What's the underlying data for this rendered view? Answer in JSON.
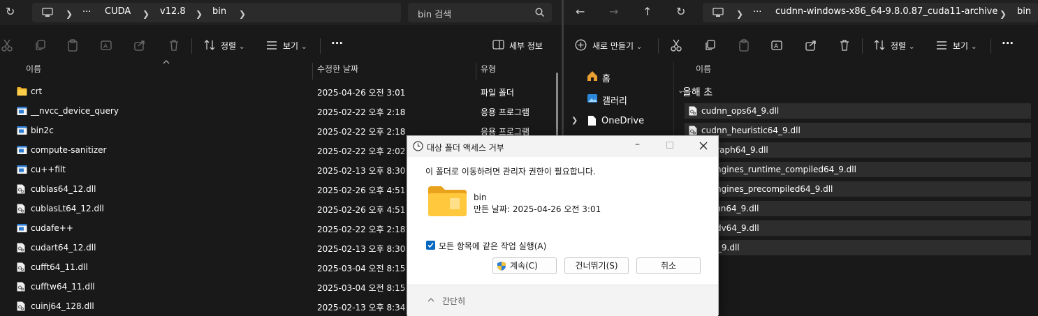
{
  "left": {
    "breadcrumb": [
      "CUDA",
      "v12.8",
      "bin"
    ],
    "more": "···",
    "search_placeholder": "bin 검색",
    "toolbar": {
      "sort": "정렬",
      "view": "보기",
      "more": "···",
      "details": "세부 정보"
    },
    "columns": {
      "name": "이름",
      "date": "수정한 날짜",
      "type": "유형"
    },
    "files": [
      {
        "name": "crt",
        "date": "2025-04-26 오전 3:01",
        "type": "파일 폴더",
        "icon": "folder-icon"
      },
      {
        "name": "__nvcc_device_query",
        "date": "2025-02-22 오후 2:18",
        "type": "응용 프로그램",
        "icon": "app-icon"
      },
      {
        "name": "bin2c",
        "date": "2025-02-22 오후 2:18",
        "type": "응용 프로그램",
        "icon": "app-icon"
      },
      {
        "name": "compute-sanitizer",
        "date": "2025-02-22 오후 2:02",
        "type": "",
        "icon": "app-icon"
      },
      {
        "name": "cu++filt",
        "date": "2025-02-13 오후 8:30",
        "type": "",
        "icon": "app-icon"
      },
      {
        "name": "cublas64_12.dll",
        "date": "2025-02-26 오후 4:51",
        "type": "",
        "icon": "dll-icon"
      },
      {
        "name": "cublasLt64_12.dll",
        "date": "2025-02-26 오후 4:51",
        "type": "",
        "icon": "dll-icon"
      },
      {
        "name": "cudafe++",
        "date": "2025-02-22 오후 2:18",
        "type": "",
        "icon": "app-icon"
      },
      {
        "name": "cudart64_12.dll",
        "date": "2025-02-13 오후 8:30",
        "type": "",
        "icon": "dll-icon"
      },
      {
        "name": "cufft64_11.dll",
        "date": "2025-03-04 오전 8:15",
        "type": "",
        "icon": "dll-icon"
      },
      {
        "name": "cufftw64_11.dll",
        "date": "2025-03-04 오전 8:15",
        "type": "",
        "icon": "dll-icon"
      },
      {
        "name": "cuinj64_128.dll",
        "date": "2025-02-13 오후 8:34",
        "type": "",
        "icon": "dll-icon"
      }
    ]
  },
  "right": {
    "breadcrumb": [
      "cudnn-windows-x86_64-9.8.0.87_cuda11-archive",
      "bin"
    ],
    "more": "···",
    "toolbar": {
      "new": "새로 만들기",
      "sort": "정렬",
      "view": "보기",
      "more": "···"
    },
    "nav": {
      "home": "홈",
      "gallery": "갤러리",
      "onedrive": "OneDrive"
    },
    "column_name": "이름",
    "group": "올해 초",
    "files": [
      "cudnn_ops64_9.dll",
      "cudnn_heuristic64_9.dll",
      "n_graph64_9.dll",
      "n_engines_runtime_compiled64_9.dll",
      "n_engines_precompiled64_9.dll",
      "n_cnn64_9.dll",
      "n_adv64_9.dll",
      "n64_9.dll"
    ]
  },
  "dialog": {
    "title": "대상 폴더 액세스 거부",
    "message": "이 폴더로 이동하려면 관리자 권한이 필요합니다.",
    "folder_name": "bin",
    "created": "만든 날짜: 2025-04-26 오전 3:01",
    "checkbox_label": "모든 항목에 같은 작업 실행(A)",
    "checkbox_checked": true,
    "continue": "계속(C)",
    "skip": "건너뛰기(S)",
    "cancel": "취소",
    "less": "간단히"
  }
}
